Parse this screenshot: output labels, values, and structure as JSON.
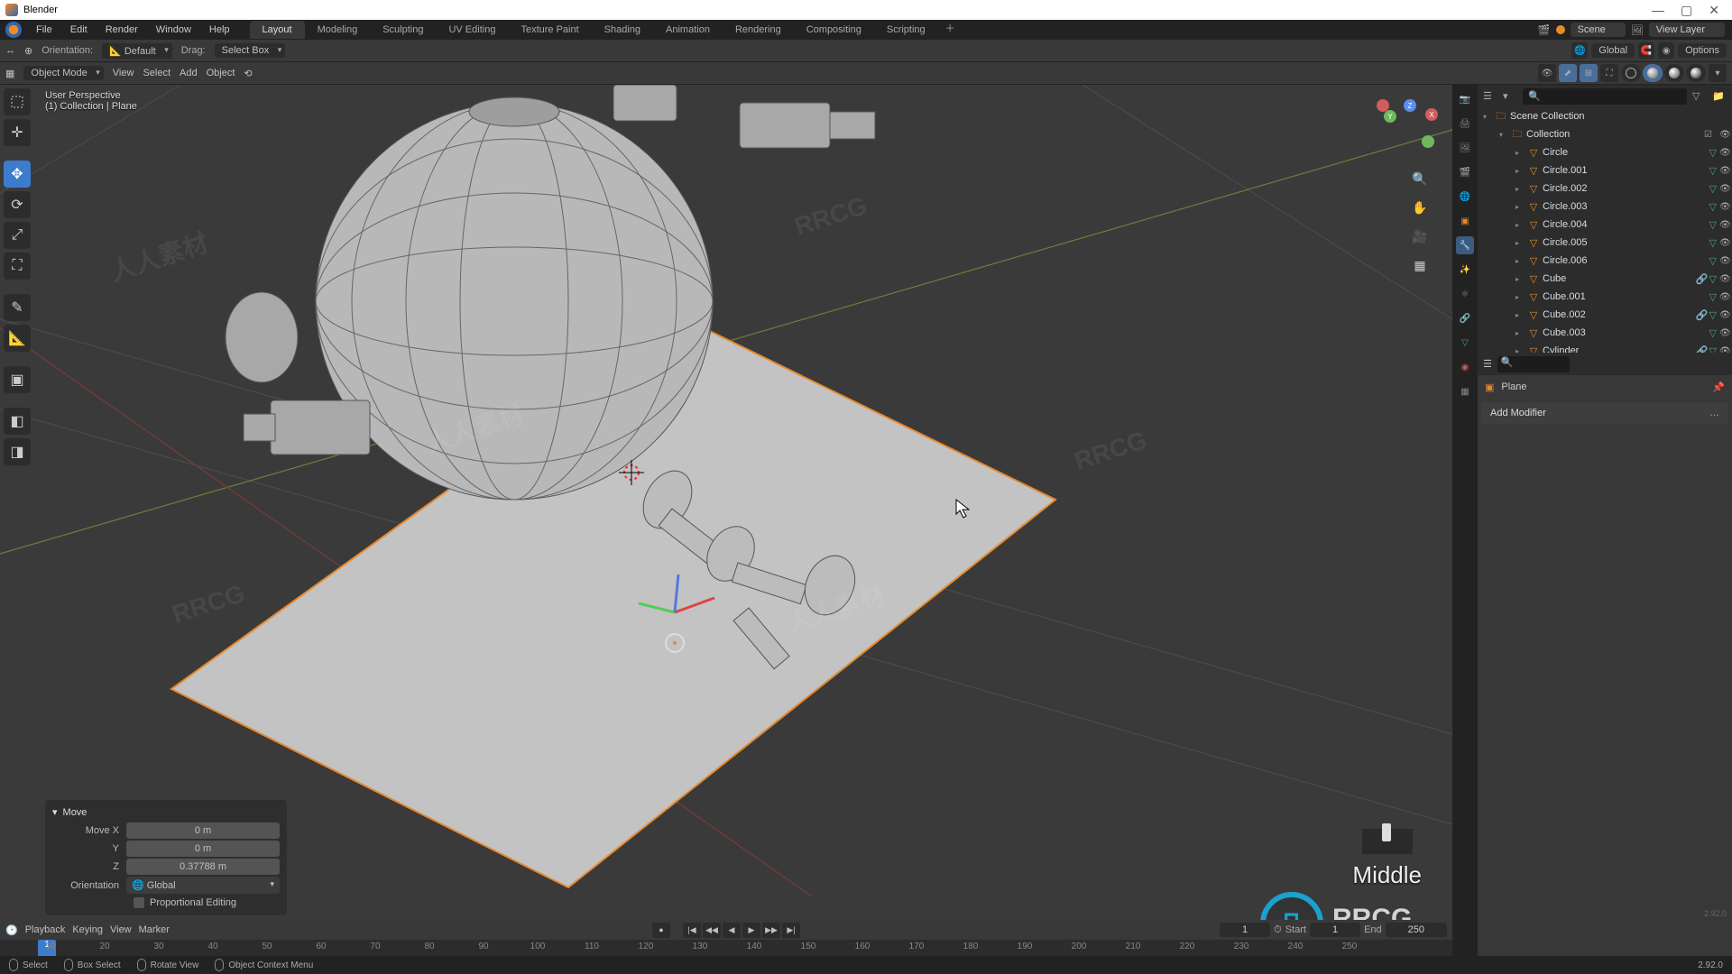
{
  "window_title": "Blender",
  "menubar": {
    "items": [
      "File",
      "Edit",
      "Render",
      "Window",
      "Help"
    ]
  },
  "workspaces": {
    "tabs": [
      "Layout",
      "Modeling",
      "Sculpting",
      "UV Editing",
      "Texture Paint",
      "Shading",
      "Animation",
      "Rendering",
      "Compositing",
      "Scripting"
    ],
    "active": "Layout"
  },
  "scene_field": "Scene",
  "viewlayer_field": "View Layer",
  "header2": {
    "orientation_label": "Orientation:",
    "orientation_value": "Default",
    "drag_label": "Drag:",
    "drag_value": "Select Box",
    "global_label": "Global",
    "options_label": "Options"
  },
  "header3": {
    "mode": "Object Mode",
    "menus": [
      "View",
      "Select",
      "Add",
      "Object"
    ]
  },
  "viewport_labels": {
    "perspective": "User Perspective",
    "context": "(1)  Collection | Plane"
  },
  "op_panel": {
    "title": "Move",
    "rows": [
      {
        "k": "Move X",
        "v": "0 m"
      },
      {
        "k": "Y",
        "v": "0 m"
      },
      {
        "k": "Z",
        "v": "0.37788 m"
      }
    ],
    "orientation_label": "Orientation",
    "orientation_value": "Global",
    "proportional_label": "Proportional Editing"
  },
  "middle_indicator": "Middle",
  "timeline": {
    "menus": [
      "Playback",
      "Keying",
      "View",
      "Marker"
    ],
    "current": "1",
    "start_label": "Start",
    "start": "1",
    "end_label": "End",
    "end": "250",
    "ticks": [
      "10",
      "20",
      "30",
      "40",
      "50",
      "60",
      "70",
      "80",
      "90",
      "100",
      "110",
      "120",
      "130",
      "140",
      "150",
      "160",
      "170",
      "180",
      "190",
      "200",
      "210",
      "220",
      "230",
      "240",
      "250"
    ]
  },
  "statusbar": {
    "hints": [
      "Select",
      "Box Select",
      "Rotate View",
      "Object Context Menu"
    ],
    "version": "2.92.0"
  },
  "outliner": {
    "root": "Scene Collection",
    "collection": "Collection",
    "items": [
      {
        "name": "Circle",
        "kind": "mesh"
      },
      {
        "name": "Circle.001",
        "kind": "mesh"
      },
      {
        "name": "Circle.002",
        "kind": "mesh"
      },
      {
        "name": "Circle.003",
        "kind": "mesh"
      },
      {
        "name": "Circle.004",
        "kind": "mesh"
      },
      {
        "name": "Circle.005",
        "kind": "mesh"
      },
      {
        "name": "Circle.006",
        "kind": "mesh"
      },
      {
        "name": "Cube",
        "kind": "mesh",
        "linked": true
      },
      {
        "name": "Cube.001",
        "kind": "mesh"
      },
      {
        "name": "Cube.002",
        "kind": "mesh",
        "linked": true
      },
      {
        "name": "Cube.003",
        "kind": "mesh"
      },
      {
        "name": "Cylinder",
        "kind": "mesh",
        "linked": true
      }
    ]
  },
  "properties": {
    "breadcrumb_obj": "Plane",
    "add_modifier": "Add Modifier"
  },
  "watermark": "人人素材 RRCG"
}
